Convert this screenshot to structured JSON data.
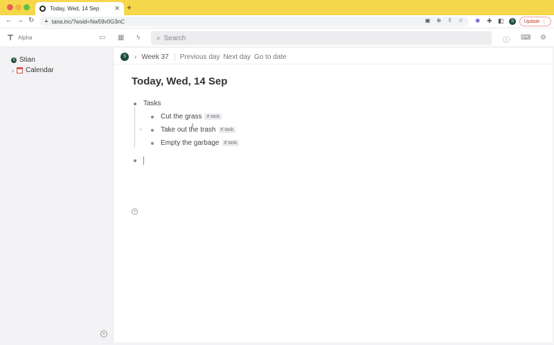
{
  "browser": {
    "tab_title": "Today, Wed, 14 Sep",
    "url": "tana.inc/?wsid=Nw59v0G3nC",
    "profile_initial": "S",
    "update_label": "Update"
  },
  "app": {
    "product_label": "Alpha",
    "search_placeholder": "Search"
  },
  "sidebar": {
    "workspace_name": "Stian",
    "workspace_initial": "S",
    "items": [
      {
        "label": "Calendar",
        "icon": "calendar-icon"
      }
    ]
  },
  "breadcrumb": {
    "avatar_initial": "S",
    "week": "Week 37",
    "links": [
      "Previous day",
      "Next day",
      "Go to date"
    ]
  },
  "page": {
    "title": "Today, Wed, 14 Sep",
    "root_node": "Tasks",
    "children": [
      {
        "label": "Cut the grass",
        "tag": "# task"
      },
      {
        "label": "Take out the trash",
        "tag": "# task"
      },
      {
        "label": "Empty the garbage",
        "tag": "# task"
      }
    ]
  },
  "colors": {
    "titlebar": "#f6d74b",
    "avatar": "#1e4d3a",
    "update_text": "#c0392b"
  }
}
